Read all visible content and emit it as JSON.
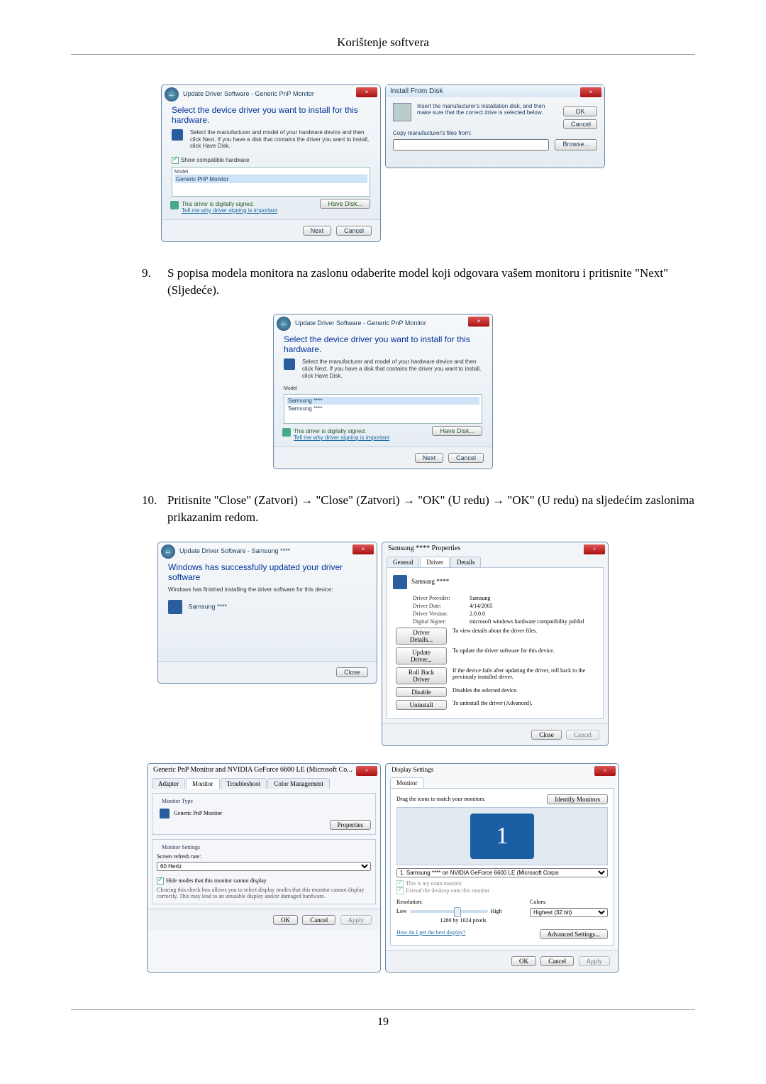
{
  "doc": {
    "header": "Korištenje softvera",
    "page_number": "19"
  },
  "step9": {
    "num": "9.",
    "text": "S popisa modela monitora na zaslonu odaberite model koji odgovara vašem monitoru i pritisnite \"Next\" (Sljedeće)."
  },
  "step10": {
    "num": "10.",
    "text": "Pritisnite \"Close\" (Zatvori) → \"Close\" (Zatvori) → \"OK\" (U redu) → \"OK\" (U redu) na sljedećim zaslonima prikazanim redom."
  },
  "wiz1": {
    "breadcrumb": "Update Driver Software - Generic PnP Monitor",
    "heading": "Select the device driver you want to install for this hardware.",
    "sub": "Select the manufacturer and model of your hardware device and then click Next. If you have a disk that contains the driver you want to install, click Have Disk.",
    "compat_label": "Show compatible hardware",
    "model_hdr": "Model",
    "model0": "Generic PnP Monitor",
    "signed": "This driver is digitally signed.",
    "tell": "Tell me why driver signing is important",
    "have_disk": "Have Disk...",
    "next": "Next",
    "cancel": "Cancel"
  },
  "ifd": {
    "title": "Install From Disk",
    "msg": "Insert the manufacturer's installation disk, and then make sure that the correct drive is selected below.",
    "ok": "OK",
    "cancel": "Cancel",
    "copy": "Copy manufacturer's files from:",
    "browse": "Browse..."
  },
  "wiz2": {
    "breadcrumb": "Update Driver Software - Generic PnP Monitor",
    "heading": "Select the device driver you want to install for this hardware.",
    "sub": "Select the manufacturer and model of your hardware device and then click Next. If you have a disk that contains the driver you want to install, click Have Disk.",
    "model_hdr": "Model",
    "model0": "Samsung ****",
    "model1": "Samsung ****",
    "signed": "This driver is digitally signed.",
    "tell": "Tell me why driver signing is important",
    "have_disk": "Have Disk...",
    "next": "Next",
    "cancel": "Cancel"
  },
  "wiz3": {
    "breadcrumb": "Update Driver Software - Samsung ****",
    "heading": "Windows has successfully updated your driver software",
    "sub": "Windows has finished installing the driver software for this device:",
    "device": "Samsung ****",
    "close": "Close"
  },
  "props": {
    "title": "Samsung **** Properties",
    "tab_general": "General",
    "tab_driver": "Driver",
    "tab_details": "Details",
    "device": "Samsung ****",
    "row_provider_l": "Driver Provider:",
    "row_provider_v": "Samsung",
    "row_date_l": "Driver Date:",
    "row_date_v": "4/14/2005",
    "row_ver_l": "Driver Version:",
    "row_ver_v": "2.0.0.0",
    "row_signer_l": "Digital Signer:",
    "row_signer_v": "microsoft windows hardware compatibility publisl",
    "btn_details": "Driver Details...",
    "btn_details_d": "To view details about the driver files.",
    "btn_update": "Update Driver...",
    "btn_update_d": "To update the driver software for this device.",
    "btn_rollback": "Roll Back Driver",
    "btn_rollback_d": "If the device fails after updating the driver, roll back to the previously installed driver.",
    "btn_disable": "Disable",
    "btn_disable_d": "Disables the selected device.",
    "btn_uninstall": "Uninstall",
    "btn_uninstall_d": "To uninstall the driver (Advanced).",
    "close": "Close",
    "cancel": "Cancel"
  },
  "gfx": {
    "title": "Generic PnP Monitor and NVIDIA GeForce 6600 LE (Microsoft Co...",
    "tab_adapter": "Adapter",
    "tab_monitor": "Monitor",
    "tab_trouble": "Troubleshoot",
    "tab_color": "Color Management",
    "mt_label": "Monitor Type",
    "mt_value": "Generic PnP Monitor",
    "mt_props": "Properties",
    "ms_label": "Monitor Settings",
    "refresh_label": "Screen refresh rate:",
    "refresh_value": "60 Hertz",
    "hide_modes": "Hide modes that this monitor cannot display",
    "hide_desc": "Clearing this check box allows you to select display modes that this monitor cannot display correctly. This may lead to an unusable display and/or damaged hardware.",
    "ok": "OK",
    "cancel": "Cancel",
    "apply": "Apply"
  },
  "disp": {
    "title": "Display Settings",
    "tab_monitor": "Monitor",
    "drag_msg": "Drag the icons to match your monitors.",
    "identify": "Identify Monitors",
    "combo": "1. Samsung **** on NVIDIA GeForce 6600 LE (Microsoft Corpo",
    "main": "This is my main monitor",
    "extend": "Extend the desktop onto this monitor",
    "res_label": "Resolution:",
    "low": "Low",
    "high": "High",
    "res_value": "1280 by 1024 pixels",
    "colors_label": "Colors:",
    "colors_value": "Highest (32 bit)",
    "best": "How do I get the best display?",
    "advanced": "Advanced Settings...",
    "ok": "OK",
    "cancel": "Cancel",
    "apply": "Apply",
    "mon_num": "1"
  }
}
